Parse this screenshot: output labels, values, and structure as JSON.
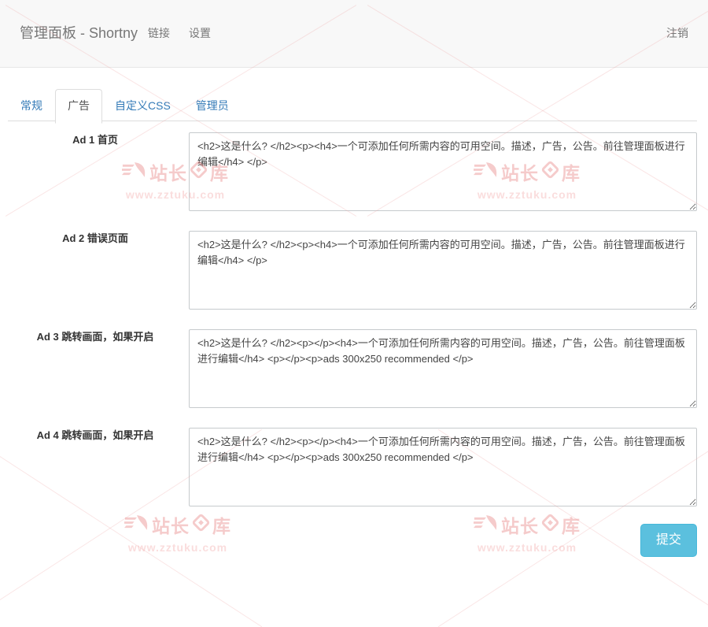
{
  "navbar": {
    "brand": "管理面板 - Shortny",
    "links": [
      {
        "label": "链接"
      },
      {
        "label": "设置"
      }
    ],
    "logout_label": "注销"
  },
  "tabs": [
    {
      "label": "常规",
      "active": false
    },
    {
      "label": "广告",
      "active": true
    },
    {
      "label": "自定义CSS",
      "active": false
    },
    {
      "label": "管理员",
      "active": false
    }
  ],
  "form": {
    "fields": [
      {
        "label": "Ad 1 首页",
        "value": "<h2>这是什么? </h2><p><h4>一个可添加任何所需内容的可用空间。描述，广告，公告。前往管理面板进行编辑</h4> </p>"
      },
      {
        "label": "Ad 2 错误页面",
        "value": "<h2>这是什么? </h2><p><h4>一个可添加任何所需内容的可用空间。描述，广告，公告。前往管理面板进行编辑</h4> </p>"
      },
      {
        "label": "Ad 3 跳转画面，如果开启",
        "value": "<h2>这是什么? </h2><p></p><h4>一个可添加任何所需内容的可用空间。描述，广告，公告。前往管理面板进行编辑</h4> <p></p><p>ads 300x250 recommended </p>"
      },
      {
        "label": "Ad 4 跳转画面，如果开启",
        "value": "<h2>这是什么? </h2><p></p><h4>一个可添加任何所需内容的可用空间。描述，广告，公告。前往管理面板进行编辑</h4> <p></p><p>ads 300x250 recommended </p>"
      }
    ],
    "submit_label": "提交"
  },
  "watermark": {
    "brand_left": "站长",
    "brand_right": "库",
    "url": "www.zztuku.com"
  },
  "colors": {
    "link_blue": "#337ab7",
    "submit_bg": "#5bc0de",
    "navbar_bg": "#f8f8f8",
    "navbar_text": "#777777",
    "tab_border": "#dddddd",
    "watermark_red": "#e77d7d"
  }
}
